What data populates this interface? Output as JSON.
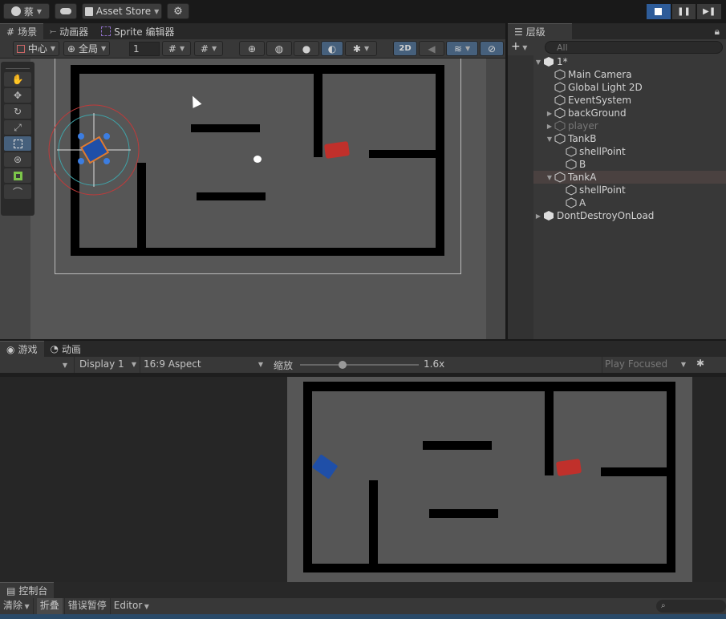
{
  "topbar": {
    "account": "蔡",
    "asset_store": "Asset Store"
  },
  "scene_tabs": [
    {
      "label": "场景"
    },
    {
      "label": "动画器"
    },
    {
      "label": "Sprite 编辑器"
    }
  ],
  "scene_toolbar": {
    "pivot": "中心",
    "space": "全局",
    "snap_value": "1",
    "mode_2d": "2D"
  },
  "hierarchy": {
    "tab_label": "层级",
    "search_placeholder": "All",
    "items": [
      {
        "label": "1*"
      },
      {
        "label": "Main Camera"
      },
      {
        "label": "Global Light 2D"
      },
      {
        "label": "EventSystem"
      },
      {
        "label": "backGround"
      },
      {
        "label": "player"
      },
      {
        "label": "TankB"
      },
      {
        "label": "shellPoint"
      },
      {
        "label": "B"
      },
      {
        "label": "TankA"
      },
      {
        "label": "shellPoint"
      },
      {
        "label": "A"
      },
      {
        "label": "DontDestroyOnLoad"
      }
    ]
  },
  "game_tabs": [
    {
      "label": "游戏"
    },
    {
      "label": "动画"
    }
  ],
  "game_toolbar": {
    "display": "Display 1",
    "aspect": "16:9 Aspect",
    "scale_label": "缩放",
    "scale_value": "1.6x",
    "scale_fraction": 0.35,
    "play_mode": "Play Focused"
  },
  "console": {
    "tab_label": "控制台",
    "clear": "清除",
    "collapse": "折叠",
    "error_pause": "错误暂停",
    "editor": "Editor"
  },
  "colors": {
    "accent": "#46607c",
    "tank_red": "#c0302b",
    "tank_blue": "#1f4fa8",
    "floor": "#565656"
  }
}
